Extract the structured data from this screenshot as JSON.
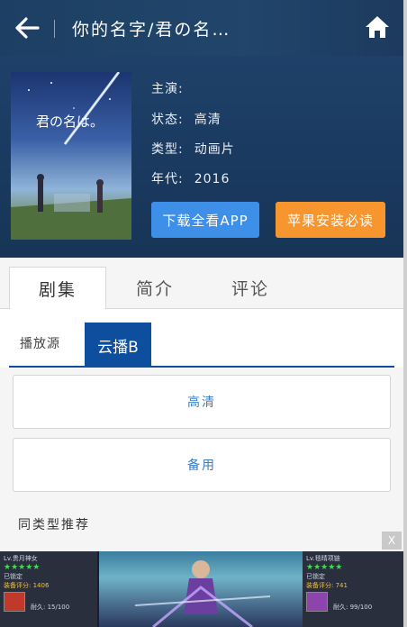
{
  "header": {
    "title": "你的名字/君の名…"
  },
  "hero": {
    "poster_text": "君の名は。",
    "info": [
      {
        "label": "主演:",
        "value": ""
      },
      {
        "label": "状态:",
        "value": "高清"
      },
      {
        "label": "类型:",
        "value": "动画片"
      },
      {
        "label": "年代:",
        "value": "2016"
      }
    ],
    "buttons": {
      "download_app": "下载全看APP",
      "apple_guide": "苹果安装必读"
    }
  },
  "tabs": [
    {
      "label": "剧集"
    },
    {
      "label": "简介"
    },
    {
      "label": "评论"
    }
  ],
  "source": {
    "label": "播放源",
    "active_tab": "云播B"
  },
  "episodes": [
    {
      "label": "高清"
    },
    {
      "label": "备用"
    }
  ],
  "recommend_title": "同类型推荐",
  "ad": {
    "close": "X",
    "left_card": {
      "name": "Lv.贵月神女",
      "tag": "已锁定",
      "score": "装备评分: 1406",
      "durability": "耐久: 15/100"
    },
    "right_card": {
      "name": "Lv.毯晴项链",
      "tag": "已锁定",
      "score": "装备评分: 741",
      "durability": "耐久: 99/100"
    }
  },
  "colors": {
    "header_bg": "#1d3f63",
    "app_button": "#3e8fe8",
    "apple_button": "#f7952e",
    "source_tab": "#0d4f9e",
    "link_text": "#3a7dc0"
  }
}
